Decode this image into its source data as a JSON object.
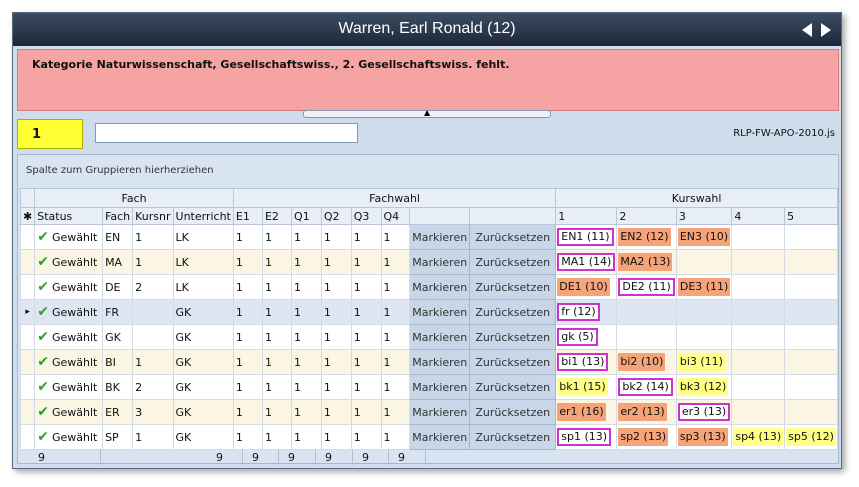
{
  "window": {
    "title": "Warren, Earl Ronald (12)"
  },
  "error": {
    "message": "Kategorie Naturwissenschaft, Gesellschaftswiss., 2. Gesellschaftswiss. fehlt."
  },
  "header": {
    "number": "1",
    "input_value": "",
    "file_label": "RLP-FW-APO-2010.js"
  },
  "grid": {
    "group_hint": "Spalte zum Gruppieren hierherziehen",
    "bands": {
      "fach": "Fach",
      "fachwahl": "Fachwahl",
      "kurswahl": "Kurswahl"
    },
    "columns": [
      "Status",
      "Fach",
      "Kursnr",
      "Unterricht",
      "E1",
      "E2",
      "Q1",
      "Q2",
      "Q3",
      "Q4",
      "",
      "",
      "1",
      "2",
      "3",
      "4",
      "5"
    ],
    "mark_label": "Markieren",
    "reset_label": "Zurücksetzen",
    "rows": [
      {
        "status": "Gewählt",
        "fach": "EN",
        "kursnr": "1",
        "unterricht": "LK",
        "e1": "1",
        "e2": "1",
        "q1": "1",
        "q2": "1",
        "q3": "1",
        "q4": "1",
        "k": [
          {
            "t": "EN1 (11)",
            "s": "sel"
          },
          {
            "t": "EN2 (12)",
            "s": "orange"
          },
          {
            "t": "EN3 (10)",
            "s": "orange"
          },
          null,
          null
        ]
      },
      {
        "status": "Gewählt",
        "fach": "MA",
        "kursnr": "1",
        "unterricht": "LK",
        "e1": "1",
        "e2": "1",
        "q1": "1",
        "q2": "1",
        "q3": "1",
        "q4": "1",
        "k": [
          {
            "t": "MA1 (14)",
            "s": "sel"
          },
          {
            "t": "MA2 (13)",
            "s": "orange"
          },
          null,
          null,
          null
        ]
      },
      {
        "status": "Gewählt",
        "fach": "DE",
        "kursnr": "2",
        "unterricht": "LK",
        "e1": "1",
        "e2": "1",
        "q1": "1",
        "q2": "1",
        "q3": "1",
        "q4": "1",
        "k": [
          {
            "t": "DE1 (10)",
            "s": "orange"
          },
          {
            "t": "DE2 (11)",
            "s": "sel"
          },
          {
            "t": "DE3 (11)",
            "s": "orange"
          },
          null,
          null
        ]
      },
      {
        "status": "Gewählt",
        "fach": "FR",
        "kursnr": "",
        "unterricht": "GK",
        "e1": "1",
        "e2": "1",
        "q1": "1",
        "q2": "1",
        "q3": "1",
        "q4": "1",
        "k": [
          {
            "t": "fr (12)",
            "s": "sel"
          },
          null,
          null,
          null,
          null
        ],
        "selected": true
      },
      {
        "status": "Gewählt",
        "fach": "GK",
        "kursnr": "",
        "unterricht": "GK",
        "e1": "1",
        "e2": "1",
        "q1": "1",
        "q2": "1",
        "q3": "1",
        "q4": "1",
        "k": [
          {
            "t": "gk (5)",
            "s": "sel"
          },
          null,
          null,
          null,
          null
        ]
      },
      {
        "status": "Gewählt",
        "fach": "BI",
        "kursnr": "1",
        "unterricht": "GK",
        "e1": "1",
        "e2": "1",
        "q1": "1",
        "q2": "1",
        "q3": "1",
        "q4": "1",
        "k": [
          {
            "t": "bi1 (13)",
            "s": "sel"
          },
          {
            "t": "bi2 (10)",
            "s": "orange"
          },
          {
            "t": "bi3 (11)",
            "s": "yellow"
          },
          null,
          null
        ]
      },
      {
        "status": "Gewählt",
        "fach": "BK",
        "kursnr": "2",
        "unterricht": "GK",
        "e1": "1",
        "e2": "1",
        "q1": "1",
        "q2": "1",
        "q3": "1",
        "q4": "1",
        "k": [
          {
            "t": "bk1 (15)",
            "s": "yellow"
          },
          {
            "t": "bk2 (14)",
            "s": "sel"
          },
          {
            "t": "bk3 (12)",
            "s": "yellow"
          },
          null,
          null
        ]
      },
      {
        "status": "Gewählt",
        "fach": "ER",
        "kursnr": "3",
        "unterricht": "GK",
        "e1": "1",
        "e2": "1",
        "q1": "1",
        "q2": "1",
        "q3": "1",
        "q4": "1",
        "k": [
          {
            "t": "er1 (16)",
            "s": "orange"
          },
          {
            "t": "er2 (13)",
            "s": "orange"
          },
          {
            "t": "er3 (13)",
            "s": "sel"
          },
          null,
          null
        ]
      },
      {
        "status": "Gewählt",
        "fach": "SP",
        "kursnr": "1",
        "unterricht": "GK",
        "e1": "1",
        "e2": "1",
        "q1": "1",
        "q2": "1",
        "q3": "1",
        "q4": "1",
        "k": [
          {
            "t": "sp1 (13)",
            "s": "sel"
          },
          {
            "t": "sp2 (13)",
            "s": "orange"
          },
          {
            "t": "sp3 (13)",
            "s": "orange"
          },
          {
            "t": "sp4 (13)",
            "s": "yellow"
          },
          {
            "t": "sp5 (12)",
            "s": "yellow"
          }
        ]
      }
    ],
    "footer": {
      "count": "9",
      "e1": "9",
      "e2": "9",
      "q1": "9",
      "q2": "9",
      "q3": "9",
      "q4": "9"
    }
  },
  "colors": {
    "accent_orange": "#f5a47a",
    "accent_yellow": "#ffff88",
    "selection": "#cc33cc",
    "error_bg": "#f5a3a3",
    "header_yellow": "#ffff33"
  },
  "icons": {
    "check": "check-icon",
    "prev": "arrow-left-icon",
    "next": "arrow-right-icon",
    "splitter": "caret-up-icon"
  }
}
